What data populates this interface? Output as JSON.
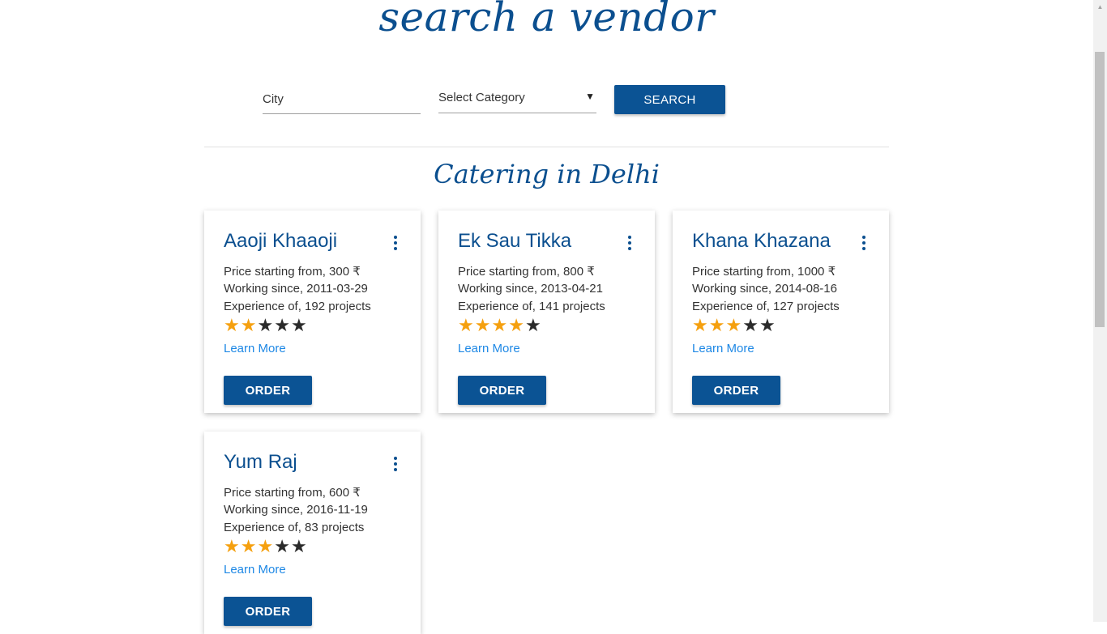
{
  "page": {
    "title": "search a vendor",
    "section_title": "Catering in Delhi"
  },
  "search": {
    "city_placeholder": "City",
    "category_value": "Select Category",
    "category_arrow": "▼",
    "button_label": "SEARCH"
  },
  "colors": {
    "accent": "#0b4f8f",
    "button": "#0b5394",
    "link": "#1e88e5",
    "star_filled": "#f5a00f",
    "star_empty": "#2b2b2b"
  },
  "vendors": [
    {
      "name": "Aaoji Khaaoji",
      "price": "Price starting from, 300 ₹",
      "since": "Working since, 2011-03-29",
      "experience": "Experience of, 192 projects",
      "rating": 2,
      "learn_more": "Learn More",
      "order_label": "ORDER"
    },
    {
      "name": "Ek Sau Tikka",
      "price": "Price starting from, 800 ₹",
      "since": "Working since, 2013-04-21",
      "experience": "Experience of, 141 projects",
      "rating": 4,
      "learn_more": "Learn More",
      "order_label": "ORDER"
    },
    {
      "name": "Khana Khazana",
      "price": "Price starting from, 1000 ₹",
      "since": "Working since, 2014-08-16",
      "experience": "Experience of, 127 projects",
      "rating": 3,
      "learn_more": "Learn More",
      "order_label": "ORDER"
    },
    {
      "name": "Yum Raj",
      "price": "Price starting from, 600 ₹",
      "since": "Working since, 2016-11-19",
      "experience": "Experience of, 83 projects",
      "rating": 3,
      "learn_more": "Learn More",
      "order_label": "ORDER"
    }
  ],
  "rating_max": 5
}
